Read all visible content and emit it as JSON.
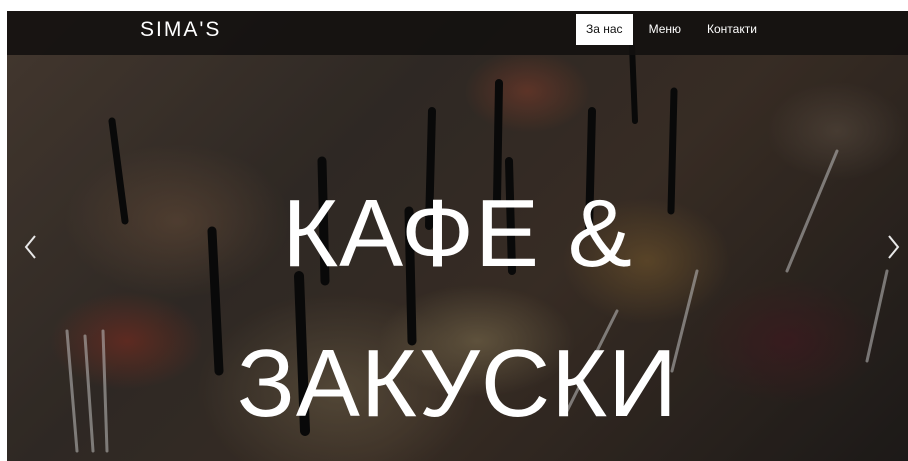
{
  "brand": {
    "name": "SIMA'S"
  },
  "nav": {
    "items": [
      {
        "label": "За нас",
        "active": true
      },
      {
        "label": "Меню",
        "active": false
      },
      {
        "label": "Контакти",
        "active": false
      }
    ]
  },
  "hero": {
    "line1": "КАФЕ &",
    "line2": "ЗАКУСКИ",
    "prev_icon": "chevron-left-icon",
    "next_icon": "chevron-right-icon"
  },
  "colors": {
    "navbar": "#12100f",
    "active_nav_bg": "#ffffff",
    "text": "#ffffff"
  }
}
